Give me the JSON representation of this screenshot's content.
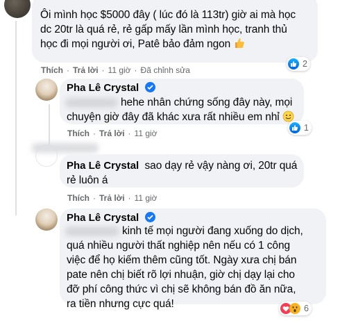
{
  "comments": [
    {
      "text_lines": [
        "Ôi mình học $5000 đây ( lúc đó là 113tr) giờ ai mà học",
        "dc 20tr là quá rẻ, rẻ gấp mấy lần mình học, tranh thủ",
        "học đi mọi người ơi, Patê bảo đảm ngon"
      ],
      "emoji": "thumbs-up-icon",
      "actions": {
        "like": "Thích",
        "reply": "Trả lời",
        "time": "11 giờ",
        "edited": "Đã chỉnh sửa"
      },
      "reaction_count": "2"
    },
    {
      "author": "Pha Lê Crystal",
      "text_lines": [
        "hehe nhân chứng sống đây này, mọi",
        "chuyện giờ đây đã khác xưa rất nhiều em nhỉ"
      ],
      "emoji": "smile-icon",
      "actions": {
        "like": "Thích",
        "reply": "Trả lời",
        "time": "11 giờ"
      },
      "reaction_count": "1"
    },
    {
      "author": "Pha Lê Crystal",
      "text_lines": [
        "sao dạy rẻ vậy nàng ơi, 20tr quá",
        "rẻ luôn á"
      ],
      "actions": {
        "like": "Thích",
        "reply": "Trả lời",
        "time": "11 giờ"
      }
    },
    {
      "author": "Pha Lê Crystal",
      "text_lines": [
        "kinh tế mọi người đang xuống do dịch,",
        "quá nhiều người thất nghiệp nên nếu có 1 công",
        "việc để họ kiếm thêm cũng tốt. Ngày xưa chị bán",
        "pate nên chị biết rõ lợi nhuận, giờ chị dạy lại cho",
        "đỡ phí công thức vì chị sẽ không bán đồ ăn nữa,",
        "ra tiền nhưng cực quá!"
      ],
      "reaction_count": "6"
    }
  ],
  "colors": {
    "bubble": "#f0f2f5",
    "meta": "#65676b",
    "like_blue": "#1877f2",
    "love_red": "#f33e58",
    "wow_yellow": "#f7b125"
  }
}
